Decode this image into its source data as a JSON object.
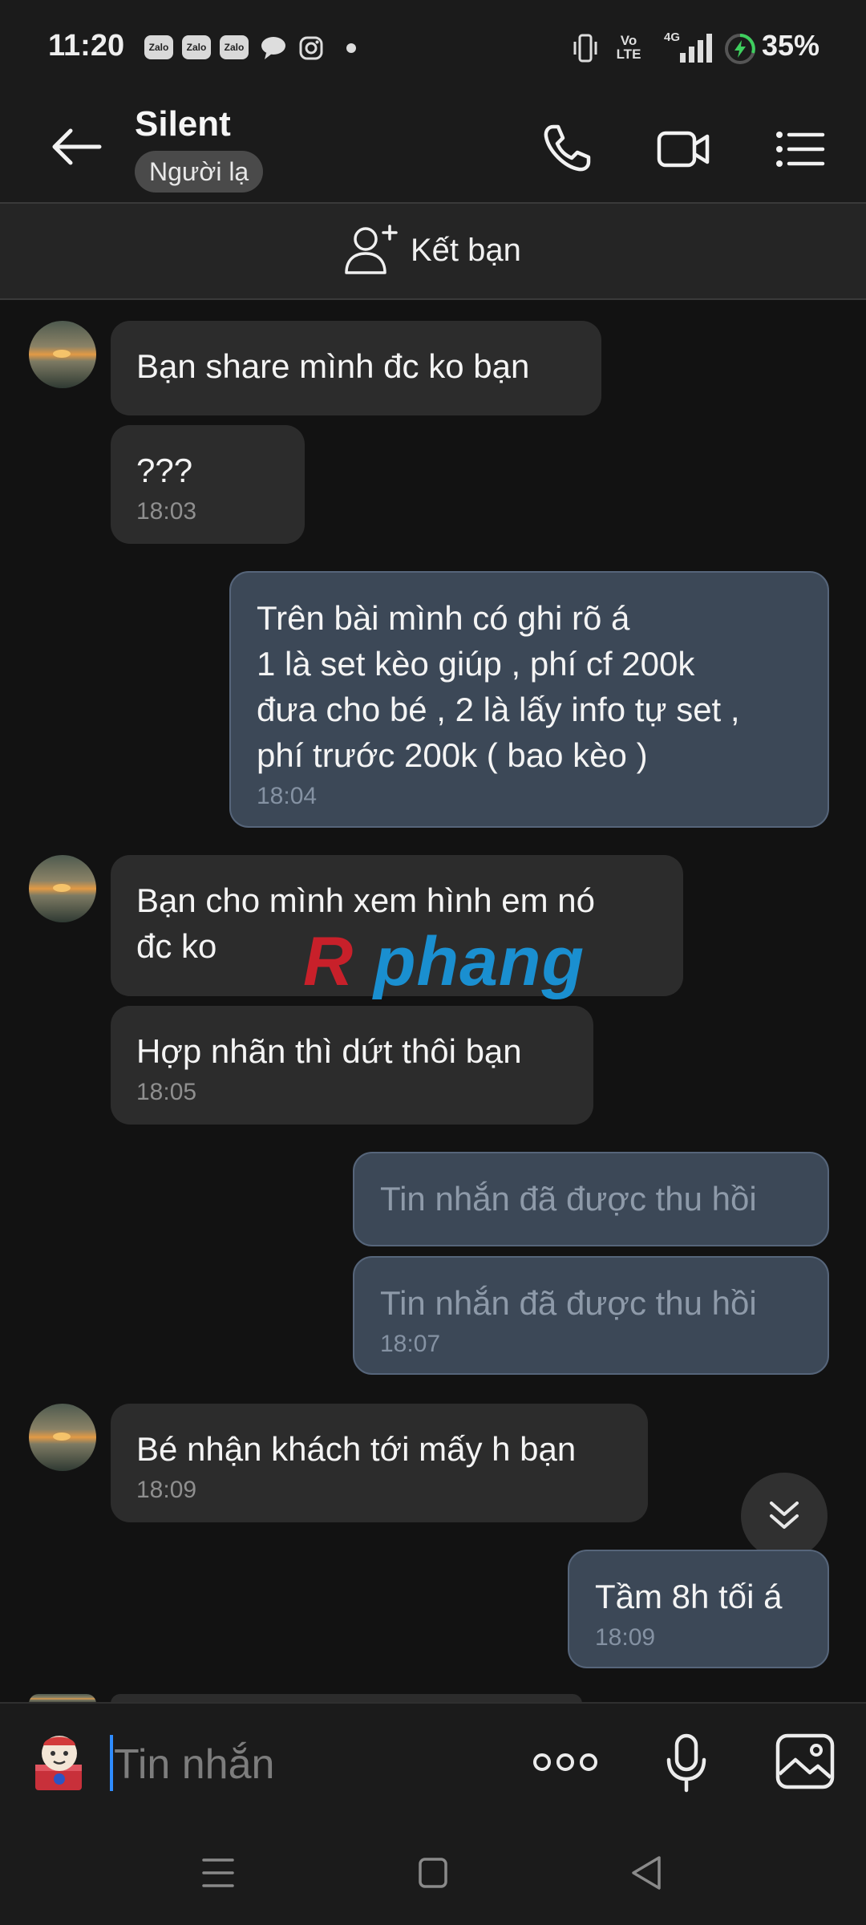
{
  "status_bar": {
    "time": "11:20",
    "app_icons": [
      "Zalo",
      "Zalo",
      "Zalo"
    ],
    "network": "Vo LTE",
    "network_gen": "4G",
    "battery": "35%"
  },
  "header": {
    "title": "Silent",
    "badge": "Người lạ"
  },
  "friend_bar": {
    "label": "Kết bạn"
  },
  "messages": [
    {
      "dir": "in",
      "text": "Bạn share mình đc ko bạn",
      "time": ""
    },
    {
      "dir": "in",
      "text": "???",
      "time": "18:03"
    },
    {
      "dir": "out",
      "text": "Trên bài mình có ghi rõ á\n1 là set kèo giúp , phí cf 200k\nđưa cho bé , 2 là lấy info tự set ,\nphí trước 200k ( bao kèo )",
      "time": "18:04"
    },
    {
      "dir": "in",
      "text": "Bạn cho mình xem hình em nó\nđc ko",
      "time": ""
    },
    {
      "dir": "in",
      "text": "Hợp nhãn thì dứt thôi bạn",
      "time": "18:05"
    },
    {
      "dir": "out",
      "text": "Tin nhắn đã được thu hồi",
      "time": "",
      "recalled": true
    },
    {
      "dir": "out",
      "text": "Tin nhắn đã được thu hồi",
      "time": "18:07",
      "recalled": true
    },
    {
      "dir": "in",
      "text": "Bé nhận khách tới mấy h bạn",
      "time": "18:09"
    },
    {
      "dir": "out",
      "text": "Tầm 8h tối á",
      "time": "18:09"
    }
  ],
  "watermark": "Rphang",
  "composer": {
    "placeholder": "Tin nhắn"
  },
  "colors": {
    "background": "#121212",
    "incoming_bubble": "#2c2c2c",
    "outgoing_bubble": "#3c4857",
    "caret": "#2f8cff",
    "watermark_red": "#c8202a",
    "watermark_blue": "#1a8fd0"
  },
  "icons": {
    "back": "arrow-left-icon",
    "call": "phone-icon",
    "video": "video-camera-icon",
    "menu": "list-menu-icon",
    "add_friend": "add-user-icon",
    "scroll_down": "double-chevron-down-icon",
    "sticker": "sticker-icon",
    "more": "more-dots-icon",
    "mic": "microphone-icon",
    "image": "image-icon"
  }
}
